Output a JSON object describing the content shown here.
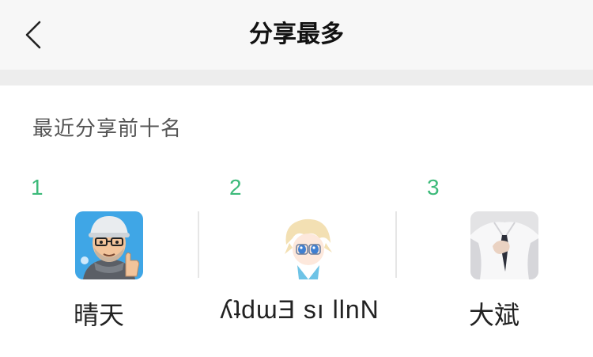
{
  "navbar": {
    "title": "分享最多",
    "back_icon": "chevron-left-icon"
  },
  "section": {
    "title": "最近分享前十名"
  },
  "ranking": [
    {
      "rank": "1",
      "name": "晴天",
      "avatar": "avatar-cartoon-man-thumbs-up"
    },
    {
      "rank": "2",
      "name": "ʎʇdɯƎ sı llnN",
      "avatar": "avatar-anime-character"
    },
    {
      "rank": "3",
      "name": "大斌",
      "avatar": "avatar-photo-man-white-shirt"
    }
  ],
  "colors": {
    "rank_number": "#3dba7a",
    "navbar_bg": "#f7f7f7",
    "separator_bg": "#ededed"
  }
}
